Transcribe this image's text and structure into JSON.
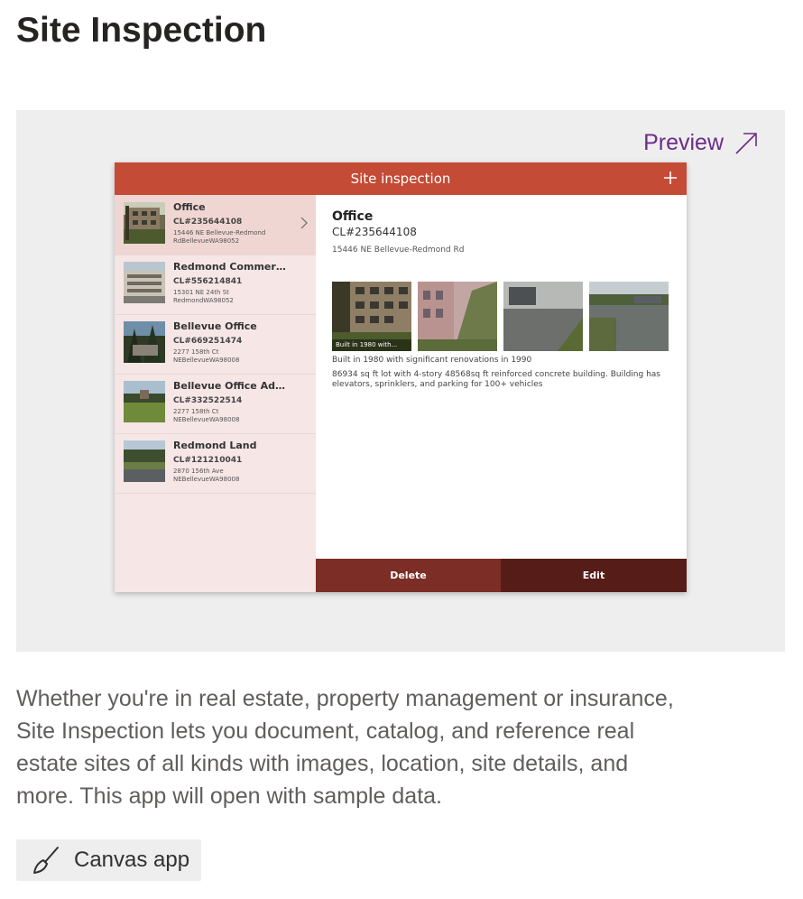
{
  "page": {
    "title": "Site Inspection",
    "description": "Whether you're in real estate, property management or insurance, Site Inspection lets you document, catalog, and reference real estate sites of all kinds with images, location, site details, and more. This app will open with sample data.",
    "app_type": "Canvas app"
  },
  "preview": {
    "label": "Preview",
    "icon": "arrow-up-right-icon"
  },
  "app": {
    "title": "Site inspection",
    "add_icon": "plus-icon",
    "sites": [
      {
        "name": "Office",
        "id": "CL#235644108",
        "address": "15446 NE Bellevue-Redmond RdBellevueWA98052"
      },
      {
        "name": "Redmond Commerc...",
        "id": "CL#556214841",
        "address": "15301 NE 24th St RedmondWA98052"
      },
      {
        "name": "Bellevue Office",
        "id": "CL#669251474",
        "address": "2277 158th Ct NEBellevueWA98008"
      },
      {
        "name": "Bellevue Office Add...",
        "id": "CL#332522514",
        "address": "2277 158th Ct NEBellevueWA98008"
      },
      {
        "name": "Redmond Land",
        "id": "CL#121210041",
        "address": "2870 156th Ave NEBellevueWA98008"
      }
    ],
    "detail": {
      "name": "Office",
      "id": "CL#235644108",
      "address": "15446 NE Bellevue-Redmond Rd",
      "photo_caption": "Built in 1980 with...",
      "built": "Built  in 1980 with significant renovations in 1990",
      "description": "86934 sq ft lot with 4-story 48568sq ft reinforced concrete building. Building has elevators, sprinklers, and parking for 100+ vehicles"
    },
    "buttons": {
      "delete": "Delete",
      "edit": "Edit"
    }
  },
  "colors": {
    "header": "#c44b35",
    "sidebar": "#f6e6e6",
    "delete_button": "#7b2d26",
    "edit_button": "#561d18",
    "preview_link": "#6b2c8a"
  }
}
